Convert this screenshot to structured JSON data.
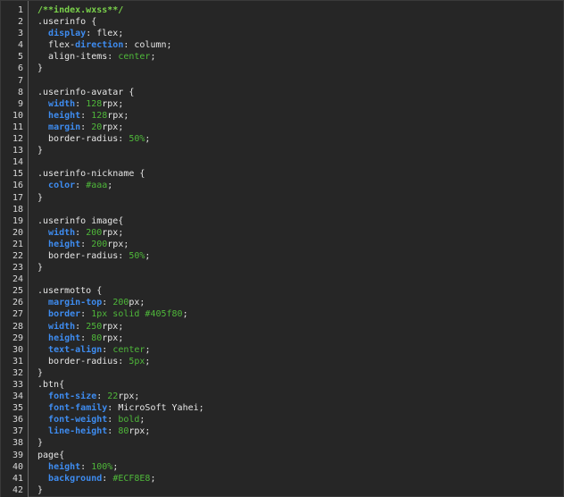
{
  "file": {
    "comment": "/**index.wxss**/"
  },
  "lines": [
    {
      "n": "1",
      "tokens": [
        {
          "t": "/**index.wxss**/",
          "c": "comment"
        }
      ]
    },
    {
      "n": "2",
      "tokens": [
        {
          "t": ".userinfo {",
          "c": "sel"
        }
      ]
    },
    {
      "n": "3",
      "tokens": [
        {
          "t": "  ",
          "c": "punct"
        },
        {
          "t": "display",
          "c": "prop"
        },
        {
          "t": ": flex;",
          "c": "val"
        }
      ]
    },
    {
      "n": "4",
      "tokens": [
        {
          "t": "  flex-",
          "c": "propn"
        },
        {
          "t": "direction",
          "c": "prop"
        },
        {
          "t": ": column;",
          "c": "val"
        }
      ]
    },
    {
      "n": "5",
      "tokens": [
        {
          "t": "  align-items: ",
          "c": "propn"
        },
        {
          "t": "center",
          "c": "kw"
        },
        {
          "t": ";",
          "c": "val"
        }
      ]
    },
    {
      "n": "6",
      "tokens": [
        {
          "t": "}",
          "c": "punct"
        }
      ]
    },
    {
      "n": "7",
      "tokens": []
    },
    {
      "n": "8",
      "tokens": [
        {
          "t": ".userinfo-avatar {",
          "c": "sel"
        }
      ]
    },
    {
      "n": "9",
      "tokens": [
        {
          "t": "  ",
          "c": "punct"
        },
        {
          "t": "width",
          "c": "prop"
        },
        {
          "t": ": ",
          "c": "val"
        },
        {
          "t": "128",
          "c": "num"
        },
        {
          "t": "rpx;",
          "c": "val"
        }
      ]
    },
    {
      "n": "10",
      "tokens": [
        {
          "t": "  ",
          "c": "punct"
        },
        {
          "t": "height",
          "c": "prop"
        },
        {
          "t": ": ",
          "c": "val"
        },
        {
          "t": "128",
          "c": "num"
        },
        {
          "t": "rpx;",
          "c": "val"
        }
      ]
    },
    {
      "n": "11",
      "tokens": [
        {
          "t": "  ",
          "c": "punct"
        },
        {
          "t": "margin",
          "c": "prop"
        },
        {
          "t": ": ",
          "c": "val"
        },
        {
          "t": "20",
          "c": "num"
        },
        {
          "t": "rpx;",
          "c": "val"
        }
      ]
    },
    {
      "n": "12",
      "tokens": [
        {
          "t": "  border-radius: ",
          "c": "propn"
        },
        {
          "t": "50%",
          "c": "num"
        },
        {
          "t": ";",
          "c": "val"
        }
      ]
    },
    {
      "n": "13",
      "tokens": [
        {
          "t": "}",
          "c": "punct"
        }
      ]
    },
    {
      "n": "14",
      "tokens": []
    },
    {
      "n": "15",
      "tokens": [
        {
          "t": ".userinfo-nickname {",
          "c": "sel"
        }
      ]
    },
    {
      "n": "16",
      "tokens": [
        {
          "t": "  ",
          "c": "punct"
        },
        {
          "t": "color",
          "c": "prop"
        },
        {
          "t": ": ",
          "c": "val"
        },
        {
          "t": "#aaa",
          "c": "num"
        },
        {
          "t": ";",
          "c": "val"
        }
      ]
    },
    {
      "n": "17",
      "tokens": [
        {
          "t": "}",
          "c": "punct"
        }
      ]
    },
    {
      "n": "18",
      "tokens": []
    },
    {
      "n": "19",
      "tokens": [
        {
          "t": ".userinfo image{",
          "c": "sel"
        }
      ]
    },
    {
      "n": "20",
      "tokens": [
        {
          "t": "  ",
          "c": "punct"
        },
        {
          "t": "width",
          "c": "prop"
        },
        {
          "t": ": ",
          "c": "val"
        },
        {
          "t": "200",
          "c": "num"
        },
        {
          "t": "rpx;",
          "c": "val"
        }
      ]
    },
    {
      "n": "21",
      "tokens": [
        {
          "t": "  ",
          "c": "punct"
        },
        {
          "t": "height",
          "c": "prop"
        },
        {
          "t": ": ",
          "c": "val"
        },
        {
          "t": "200",
          "c": "num"
        },
        {
          "t": "rpx;",
          "c": "val"
        }
      ]
    },
    {
      "n": "22",
      "tokens": [
        {
          "t": "  border-radius: ",
          "c": "propn"
        },
        {
          "t": "50%",
          "c": "num"
        },
        {
          "t": ";",
          "c": "val"
        }
      ]
    },
    {
      "n": "23",
      "tokens": [
        {
          "t": "}",
          "c": "punct"
        }
      ]
    },
    {
      "n": "24",
      "tokens": []
    },
    {
      "n": "25",
      "tokens": [
        {
          "t": ".usermotto {",
          "c": "sel"
        }
      ]
    },
    {
      "n": "26",
      "tokens": [
        {
          "t": "  ",
          "c": "punct"
        },
        {
          "t": "margin-top",
          "c": "prop"
        },
        {
          "t": ": ",
          "c": "val"
        },
        {
          "t": "200",
          "c": "num"
        },
        {
          "t": "px;",
          "c": "val"
        }
      ]
    },
    {
      "n": "27",
      "tokens": [
        {
          "t": "  ",
          "c": "punct"
        },
        {
          "t": "border",
          "c": "prop"
        },
        {
          "t": ": ",
          "c": "val"
        },
        {
          "t": "1px solid #405f80",
          "c": "num"
        },
        {
          "t": ";",
          "c": "val"
        }
      ]
    },
    {
      "n": "28",
      "tokens": [
        {
          "t": "  ",
          "c": "punct"
        },
        {
          "t": "width",
          "c": "prop"
        },
        {
          "t": ": ",
          "c": "val"
        },
        {
          "t": "250",
          "c": "num"
        },
        {
          "t": "rpx;",
          "c": "val"
        }
      ]
    },
    {
      "n": "29",
      "tokens": [
        {
          "t": "  ",
          "c": "punct"
        },
        {
          "t": "height",
          "c": "prop"
        },
        {
          "t": ": ",
          "c": "val"
        },
        {
          "t": "80",
          "c": "num"
        },
        {
          "t": "rpx;",
          "c": "val"
        }
      ]
    },
    {
      "n": "30",
      "tokens": [
        {
          "t": "  ",
          "c": "punct"
        },
        {
          "t": "text-align",
          "c": "prop"
        },
        {
          "t": ": ",
          "c": "val"
        },
        {
          "t": "center",
          "c": "kw"
        },
        {
          "t": ";",
          "c": "val"
        }
      ]
    },
    {
      "n": "31",
      "tokens": [
        {
          "t": "  border-radius: ",
          "c": "propn"
        },
        {
          "t": "5px",
          "c": "num"
        },
        {
          "t": ";",
          "c": "val"
        }
      ]
    },
    {
      "n": "32",
      "tokens": [
        {
          "t": "}",
          "c": "punct"
        }
      ]
    },
    {
      "n": "33",
      "tokens": [
        {
          "t": ".btn{",
          "c": "sel"
        }
      ]
    },
    {
      "n": "34",
      "tokens": [
        {
          "t": "  ",
          "c": "punct"
        },
        {
          "t": "font-size",
          "c": "prop"
        },
        {
          "t": ": ",
          "c": "val"
        },
        {
          "t": "22",
          "c": "num"
        },
        {
          "t": "rpx;",
          "c": "val"
        }
      ]
    },
    {
      "n": "35",
      "tokens": [
        {
          "t": "  ",
          "c": "punct"
        },
        {
          "t": "font-family",
          "c": "prop"
        },
        {
          "t": ": MicroSoft Yahei;",
          "c": "val"
        }
      ]
    },
    {
      "n": "36",
      "tokens": [
        {
          "t": "  ",
          "c": "punct"
        },
        {
          "t": "font-weight",
          "c": "prop"
        },
        {
          "t": ": ",
          "c": "val"
        },
        {
          "t": "bold",
          "c": "kw"
        },
        {
          "t": ";",
          "c": "val"
        }
      ]
    },
    {
      "n": "37",
      "tokens": [
        {
          "t": "  ",
          "c": "punct"
        },
        {
          "t": "line-height",
          "c": "prop"
        },
        {
          "t": ": ",
          "c": "val"
        },
        {
          "t": "80",
          "c": "num"
        },
        {
          "t": "rpx;",
          "c": "val"
        }
      ]
    },
    {
      "n": "38",
      "tokens": [
        {
          "t": "}",
          "c": "punct"
        }
      ]
    },
    {
      "n": "39",
      "tokens": [
        {
          "t": "page{",
          "c": "sel"
        }
      ]
    },
    {
      "n": "40",
      "tokens": [
        {
          "t": "  ",
          "c": "punct"
        },
        {
          "t": "height",
          "c": "prop"
        },
        {
          "t": ": ",
          "c": "val"
        },
        {
          "t": "100%",
          "c": "num"
        },
        {
          "t": ";",
          "c": "val"
        }
      ]
    },
    {
      "n": "41",
      "tokens": [
        {
          "t": "  ",
          "c": "punct"
        },
        {
          "t": "background",
          "c": "prop"
        },
        {
          "t": ": ",
          "c": "val"
        },
        {
          "t": "#ECF8E8",
          "c": "num"
        },
        {
          "t": ";",
          "c": "val"
        }
      ]
    },
    {
      "n": "42",
      "tokens": [
        {
          "t": "}",
          "c": "punct"
        }
      ]
    }
  ],
  "colors": {
    "background": "#262626",
    "line_number": "#d8d8d8",
    "property": "#3e8cf0",
    "value_number": "#4fb83a",
    "comment": "#7ad14b",
    "text": "#e6e6e6"
  }
}
